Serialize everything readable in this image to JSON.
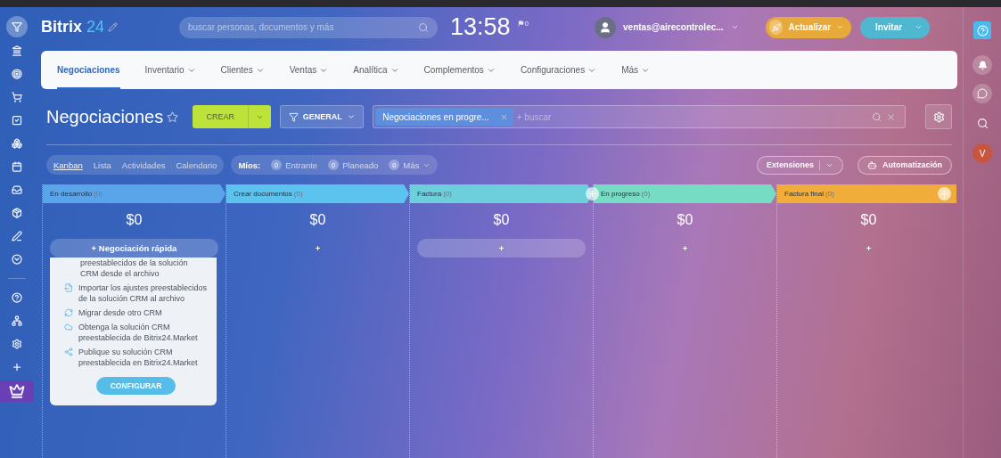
{
  "left_rail": [
    {
      "selected": true
    },
    {
      "selected": false
    },
    {
      "selected": false
    },
    {
      "selected": false
    },
    {
      "selected": false
    },
    {
      "selected": false
    },
    {
      "selected": false
    },
    {
      "selected": false
    },
    {
      "selected": false
    },
    {
      "selected": false
    },
    {
      "selected": false
    },
    {
      "selected": false
    },
    {
      "selected": false
    },
    {
      "selected": false
    },
    {
      "selected": false
    },
    {
      "selected": true
    }
  ],
  "header": {
    "logo": {
      "name": "Bitrix",
      "number": "24"
    },
    "search": {
      "placeholder": "buscar personas, documentos y más"
    },
    "clock": "13:58",
    "flag_count": "0",
    "user": "ventas@airecontrolec...",
    "buttons": [
      {
        "label": "Actualizar",
        "kind": "upgrade"
      },
      {
        "label": "Invitar",
        "kind": "invite"
      }
    ]
  },
  "nav": {
    "items": [
      {
        "label": "Negociaciones",
        "selected": true,
        "dropdown": false
      },
      {
        "label": "Inventario",
        "selected": false,
        "dropdown": true
      },
      {
        "label": "Clientes",
        "selected": false,
        "dropdown": true
      },
      {
        "label": "Ventas",
        "selected": false,
        "dropdown": true
      },
      {
        "label": "Analítica",
        "selected": false,
        "dropdown": true
      },
      {
        "label": "Complementos",
        "selected": false,
        "dropdown": true
      },
      {
        "label": "Configuraciones",
        "selected": false,
        "dropdown": true
      },
      {
        "label": "Más",
        "selected": false,
        "dropdown": true
      }
    ]
  },
  "toolbar": {
    "title": "Negociaciones",
    "create": "CREAR",
    "filter": "GENERAL",
    "filter_chip": "Negociaciones en progre...",
    "search": {
      "placeholder": "+ buscar"
    }
  },
  "views": {
    "tabs": [
      {
        "label": "Kanban",
        "selected": true
      },
      {
        "label": "Lista",
        "selected": false
      },
      {
        "label": "Actividades",
        "selected": false
      },
      {
        "label": "Calendario",
        "selected": false
      }
    ],
    "counters_label": "Míos:",
    "counters": [
      {
        "count": "0",
        "label": "Entrante",
        "dropdown": false
      },
      {
        "count": "0",
        "label": "Planeado",
        "dropdown": false
      },
      {
        "count": "0",
        "label": "Más",
        "dropdown": true
      }
    ],
    "extensions": "Extensiones",
    "automation": "Automatización"
  },
  "columns": [
    {
      "title": "En desarrollo",
      "count": "(0)",
      "color": "#5aa5ea",
      "amount": "$0",
      "add": "+ Negociación rápida",
      "add_highlighted": true,
      "header_plus": false
    },
    {
      "title": "Crear documentos",
      "count": "(0)",
      "color": "#5cc3ef",
      "amount": "$0",
      "add": "+",
      "add_highlighted": false,
      "header_plus": false
    },
    {
      "title": "Factura",
      "count": "(0)",
      "color": "#6dcfdc",
      "amount": "$0",
      "add": "+",
      "add_highlighted": true,
      "header_plus": true
    },
    {
      "title": "En progreso",
      "count": "(0)",
      "color": "#76dcc3",
      "amount": "$0",
      "add": "+",
      "add_highlighted": false,
      "header_plus": false
    },
    {
      "title": "Factura final",
      "count": "(0)",
      "color": "#f0ad3a",
      "amount": "$0",
      "add": "+",
      "add_highlighted": false,
      "header_plus": true
    }
  ],
  "setup_card": {
    "items": [
      {
        "kind": "text",
        "text": "preestablecidos de la solución CRM desde el archivo"
      },
      {
        "kind": "import",
        "text": "Importar los ajustes preestablecidos de la solución CRM al archivo"
      },
      {
        "kind": "migrate",
        "text": "Migrar desde otro CRM"
      },
      {
        "kind": "cloud",
        "text": "Obtenga la solución CRM preestablecida de Bitrix24.Market"
      },
      {
        "kind": "share",
        "text": "Publique su solución CRM preestablecida en Bitrix24.Market"
      }
    ],
    "button": "CONFIGURAR"
  },
  "right_rail": {
    "avatar": "V"
  }
}
